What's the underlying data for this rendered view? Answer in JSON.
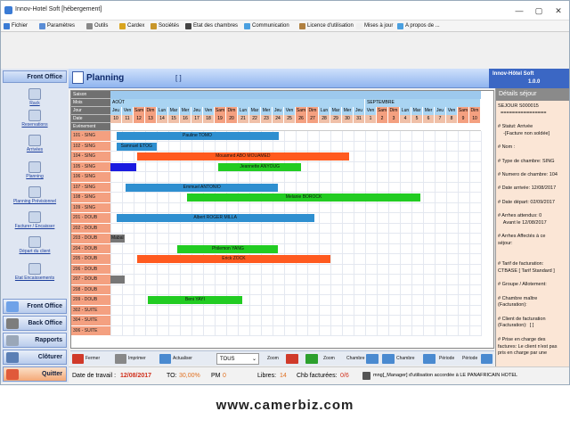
{
  "window": {
    "title": "Innov-Hotel Soft [hébergement]",
    "controls": [
      "—",
      "▢",
      "✕"
    ]
  },
  "menu": [
    {
      "label": "Fichier",
      "color": "#3a7bd5"
    },
    {
      "label": "Paramètres",
      "color": "#5a8dd6"
    },
    {
      "label": "Outils",
      "color": "#888888"
    },
    {
      "label": "Cardex",
      "color": "#d9a520"
    },
    {
      "label": "Sociétés",
      "color": "#c8962a"
    },
    {
      "label": "Etat des chambres",
      "color": "#444444"
    },
    {
      "label": "Communication",
      "color": "#4aa0e0"
    },
    {
      "label": "Licence d'utilisation",
      "color": "#b08040"
    },
    {
      "label": "Mises à jour",
      "color": "#f0f0f0"
    },
    {
      "label": "A propos de ...",
      "color": "#4aa0e0"
    }
  ],
  "sidebar": {
    "front_office_header": "Front Office",
    "nav": [
      {
        "label": "Rack"
      },
      {
        "label": "Reservations"
      },
      {
        "label": "Arrivées"
      },
      {
        "label": "Planning"
      },
      {
        "label": "Planning Prévisionnel"
      },
      {
        "label": "Facturer / Encaisser"
      },
      {
        "label": "Départ du client"
      },
      {
        "label": "Etat Encaissements"
      }
    ],
    "buttons": [
      {
        "label": "Front Office",
        "color": "#6fa2e8"
      },
      {
        "label": "Back Office",
        "color": "#7d7d7d"
      },
      {
        "label": "Rapports",
        "color": "#9aa7b8"
      },
      {
        "label": "Clôturer",
        "color": "#5b7fb5"
      },
      {
        "label": "Quitter",
        "color": "#e05a3a"
      }
    ]
  },
  "header": {
    "title": "Planning",
    "bracket": "[ ]"
  },
  "brand": {
    "line1": "Innov-Hôtel Soft",
    "line2": "1.0.0"
  },
  "planning": {
    "row_labels": [
      "Saison",
      "Mois",
      "Jour",
      "Date",
      "Evènement"
    ],
    "months": [
      {
        "label": "AOÛT",
        "start": 0,
        "span": 22
      },
      {
        "label": "SEPTEMBRE",
        "start": 22,
        "span": 10
      }
    ],
    "days": [
      "Jeu",
      "Ven",
      "Sam",
      "Dim",
      "Lun",
      "Mar",
      "Mer",
      "Jeu",
      "Ven",
      "Sam",
      "Dim",
      "Lun",
      "Mar",
      "Mer",
      "Jeu",
      "Ven",
      "Sam",
      "Dim",
      "Lun",
      "Mar",
      "Mer",
      "Jeu",
      "Ven",
      "Sam",
      "Dim",
      "Lun",
      "Mar",
      "Mer",
      "Jeu",
      "Ven",
      "Sam",
      "Dim"
    ],
    "dates": [
      "10",
      "11",
      "12",
      "13",
      "14",
      "15",
      "16",
      "17",
      "18",
      "19",
      "20",
      "21",
      "22",
      "23",
      "24",
      "25",
      "26",
      "27",
      "28",
      "29",
      "30",
      "31",
      "1",
      "2",
      "3",
      "4",
      "5",
      "6",
      "7",
      "8",
      "9",
      "10"
    ],
    "rooms": [
      "101 - SING",
      "102 - SING",
      "104 - SING",
      "105 - SING",
      "106 - SING",
      "107 - SING",
      "108 - SING",
      "109 - SING",
      "201 - DOUB",
      "202 - DOUB",
      "203 - DOUB",
      "204 - DOUB",
      "205 - DOUB",
      "206 - DOUB",
      "207 - DOUB",
      "208 - DOUB",
      "209 - DOUB",
      "302 - SUITE",
      "304 - SUITE",
      "306 - SUITE"
    ],
    "bars": [
      {
        "room": 0,
        "start": 0.5,
        "end": 14.5,
        "label": "Pauline TOMO",
        "color": "#2e8fd0"
      },
      {
        "room": 1,
        "start": 0.5,
        "end": 4.0,
        "label": "Samnuel ETOG",
        "color": "#2e8fd0"
      },
      {
        "room": 2,
        "start": 2.3,
        "end": 20.6,
        "label": "Mouamed ABO MOUAMED",
        "color": "#ff5a1f"
      },
      {
        "room": 3,
        "start": 0.0,
        "end": 2.2,
        "label": "",
        "color": "#1a1ae0"
      },
      {
        "room": 3,
        "start": 9.3,
        "end": 16.5,
        "label": "Jeannette ANYOUG",
        "color": "#22cc22"
      },
      {
        "room": 5,
        "start": 1.3,
        "end": 14.5,
        "label": "Emmuel ANTONIO",
        "color": "#2e8fd0"
      },
      {
        "room": 6,
        "start": 6.6,
        "end": 26.8,
        "label": "Melanie BOROCK",
        "color": "#22cc22"
      },
      {
        "room": 8,
        "start": 0.5,
        "end": 17.6,
        "label": "Albert ROGER MILLA",
        "color": "#2e8fd0"
      },
      {
        "room": 10,
        "start": 0.0,
        "end": 1.2,
        "label": "Mabal",
        "color": "#777777"
      },
      {
        "room": 11,
        "start": 5.8,
        "end": 14.5,
        "label": "Philemon YANG",
        "color": "#22cc22"
      },
      {
        "room": 12,
        "start": 2.3,
        "end": 19.0,
        "label": "Erick ZOCK",
        "color": "#ff5a1f"
      },
      {
        "room": 14,
        "start": 0.0,
        "end": 1.2,
        "label": "",
        "color": "#777777"
      },
      {
        "room": 16,
        "start": 3.2,
        "end": 11.4,
        "label": "Beni YAYI",
        "color": "#22cc22"
      }
    ],
    "colors": {
      "weekend": "#f4a080",
      "weekday": "#a9d4f2",
      "month": "#a9d4f2",
      "saison": "#9dc9ee"
    }
  },
  "details": {
    "header": "Détails séjour",
    "lines": [
      "SEJOUR S000015",
      "  ================",
      "",
      "# Statut: Arrivée",
      "    -[Facture non soldée]",
      "",
      "# Nom :",
      "",
      "# Type de chambre: SING",
      "",
      "# Numero de chambre: 104",
      "",
      "# Date arrivée: 12/08/2017",
      "",
      "# Date départ: 02/09/2017",
      "",
      "# Arrhes attendus: 0",
      "    Avant le 12/08/2017",
      "",
      "# Arrhes Affectés à ce",
      "séjour:",
      "",
      "",
      "# Tarif de facturation:",
      "CTBASE [ Tarif Standard ]",
      "",
      "# Groupe / Allotement:",
      "",
      "# Chambre maître",
      "(Facturation):",
      "",
      "# Client de facturation",
      "(Facturation):  [ ]",
      "",
      "# Prise en charge des",
      "factures: Le client n'est pas",
      "pris en charge par une"
    ]
  },
  "toolbar": {
    "fermer": "Fermer",
    "imprimer": "Imprimer",
    "actualiser": "Actualiser",
    "filter_value": "TOUS",
    "zoom_out": "Zoom",
    "zoom_in": "Zoom",
    "chambre_up": "Chambre",
    "chambre_down": "Chambre",
    "periode_prev": "Période",
    "periode_next": "Période"
  },
  "status": {
    "work_date_label": "Date de travail :",
    "work_date": "12/08/2017",
    "to_label": "TO:",
    "to_value": "30,00%",
    "pm_label": "PM",
    "pm_value": "0",
    "libres_label": "Libres:",
    "libres_value": "14",
    "chb_label": "Chb facturées:",
    "chb_value": "0/6",
    "user_text": "mng[_Manager] d'utilisation accordée à LE PANAFRICAIN HOTEL"
  },
  "watermark": "www.camerbiz.com"
}
